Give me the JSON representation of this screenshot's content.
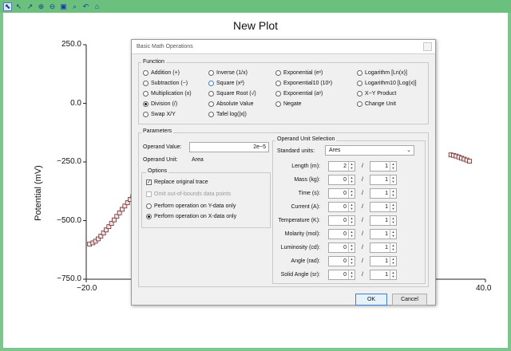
{
  "toolbar": {
    "buttons": [
      {
        "name": "pointer-select-icon",
        "glyph": "⬉"
      },
      {
        "name": "arrow-icon",
        "glyph": "↖"
      },
      {
        "name": "data-cursor-icon",
        "glyph": "↗"
      },
      {
        "name": "zoom-in-icon",
        "glyph": "⊕"
      },
      {
        "name": "zoom-out-icon",
        "glyph": "⊖"
      },
      {
        "name": "zoom-box-icon",
        "glyph": "▣"
      },
      {
        "name": "zoom-fit-icon",
        "glyph": "⌕"
      },
      {
        "name": "undo-zoom-icon",
        "glyph": "↶"
      },
      {
        "name": "home-icon",
        "glyph": "⌂"
      }
    ]
  },
  "plot": {
    "title": "New Plot",
    "ylabel": "Potential (mV)",
    "y_ticks": [
      "250.0",
      "0.0",
      "−250.0",
      "−500.0",
      "−750.0"
    ],
    "x_ticks": [
      "−20.0",
      "40.0"
    ]
  },
  "chart_data": {
    "type": "scatter",
    "title": "New Plot",
    "xlabel": "",
    "ylabel": "Potential (mV)",
    "xlim": [
      -20,
      40
    ],
    "ylim": [
      -750,
      250
    ],
    "series": [
      {
        "x": [
          -19.5,
          -19.0,
          -18.6,
          -18.2,
          -17.8,
          -17.4,
          -17.0,
          -16.6,
          -16.2,
          -15.8,
          -15.4,
          -15.0,
          -14.6,
          -14.2,
          -13.8,
          -13.4,
          -13.0,
          -12.6,
          -12.2,
          -11.8,
          -11.4,
          -11.0,
          -10.6,
          -10.2
        ],
        "y": [
          -600,
          -595,
          -588,
          -578,
          -566,
          -553,
          -540,
          -526,
          -512,
          -497,
          -482,
          -467,
          -452,
          -438,
          -424,
          -410,
          -397,
          -385,
          -374,
          -362,
          -352,
          -343,
          -335,
          -328
        ]
      },
      {
        "x": [
          34.8,
          35.2,
          35.6,
          36.0,
          36.4,
          36.8,
          37.2,
          37.6
        ],
        "y": [
          -220,
          -222,
          -225,
          -229,
          -234,
          -238,
          -242,
          -247
        ]
      }
    ]
  },
  "dialog": {
    "title": "Basic Math Operations",
    "function_label": "Function",
    "functions": [
      {
        "label": "Addition (+)",
        "selected": false
      },
      {
        "label": "Subtraction (−)",
        "selected": false
      },
      {
        "label": "Multiplication (x)",
        "selected": false
      },
      {
        "label": "Division (/)",
        "selected": true
      },
      {
        "label": "Swap X/Y",
        "selected": false
      },
      {
        "label": "Inverse (1/x)",
        "selected": false
      },
      {
        "label": "Square (x²)",
        "selected": false
      },
      {
        "label": "Square Root (√)",
        "selected": false
      },
      {
        "label": "Absolute Value",
        "selected": false
      },
      {
        "label": "Tafel log(|x|)",
        "selected": false
      },
      {
        "label": "Exponential (eˣ)",
        "selected": false
      },
      {
        "label": "Exponential10 (10ˣ)",
        "selected": false
      },
      {
        "label": "Exponential (aˣ)",
        "selected": false
      },
      {
        "label": "Negate",
        "selected": false
      },
      {
        "label": "Logarithm [Ln(x)]",
        "selected": false
      },
      {
        "label": "Logarithm10 [Log(x)]",
        "selected": false
      },
      {
        "label": "X−Y Product",
        "selected": false
      },
      {
        "label": "Change Unit",
        "selected": false
      }
    ],
    "parameters_label": "Parameters",
    "operand_value_label": "Operand Value:",
    "operand_value": "2e−5",
    "operand_unit_label": "Operand Unit:",
    "operand_unit": "Area",
    "options_label": "Options",
    "replace_trace_label": "Replace original trace",
    "replace_trace_checked": true,
    "omit_label": "Omit out-of-bounds data points",
    "y_only_label": "Perform operation on Y-data only",
    "x_only_label": "Perform operation on X-data only",
    "x_only_selected": true,
    "unit_selection_label": "Operand Unit Selection",
    "standard_units_label": "Standard units:",
    "standard_units_value": "Ares",
    "units": [
      {
        "label": "Length (m):",
        "num": "2",
        "den": "1"
      },
      {
        "label": "Mass (kg):",
        "num": "0",
        "den": "1"
      },
      {
        "label": "Time (s):",
        "num": "0",
        "den": "1"
      },
      {
        "label": "Current (A):",
        "num": "0",
        "den": "1"
      },
      {
        "label": "Temperature (K):",
        "num": "0",
        "den": "1"
      },
      {
        "label": "Molarity (mol):",
        "num": "0",
        "den": "1"
      },
      {
        "label": "Luminosity (cd):",
        "num": "0",
        "den": "1"
      },
      {
        "label": "Angle (rad):",
        "num": "0",
        "den": "1"
      },
      {
        "label": "Solid Angle (sr):",
        "num": "0",
        "den": "1"
      }
    ],
    "slash": "/",
    "ok_label": "OK",
    "cancel_label": "Cancel"
  }
}
